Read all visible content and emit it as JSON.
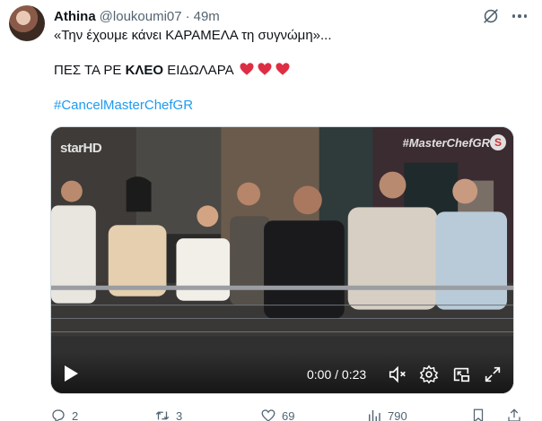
{
  "tweet": {
    "author_name": "Athina",
    "author_handle": "@loukoumi07",
    "separator": "·",
    "time": "49m",
    "line1": "«Την έχουμε κάνει ΚΑΡΑΜΕΛΑ τη συγνώμη»...",
    "line2_prefix": "ΠΕΣ ΤΑ ΡΕ ",
    "line2_bold": "ΚΛΕΟ",
    "line2_suffix": " ΕΙΔΩΛΑΡΑ",
    "hearts_icon": "red-heart-emoji",
    "heart_color": "#e0245e",
    "hashtag": "#CancelMasterChefGR",
    "hashtag_color": "#1d9bf0"
  },
  "media": {
    "channel_logo": "starHD",
    "show_tag": "#MasterChefGR",
    "badge_letter": "S",
    "time_readout": "0:00 / 0:23",
    "progress": 0.0
  },
  "actions": {
    "replies": "2",
    "retweets": "3",
    "likes": "69",
    "views": "790"
  }
}
